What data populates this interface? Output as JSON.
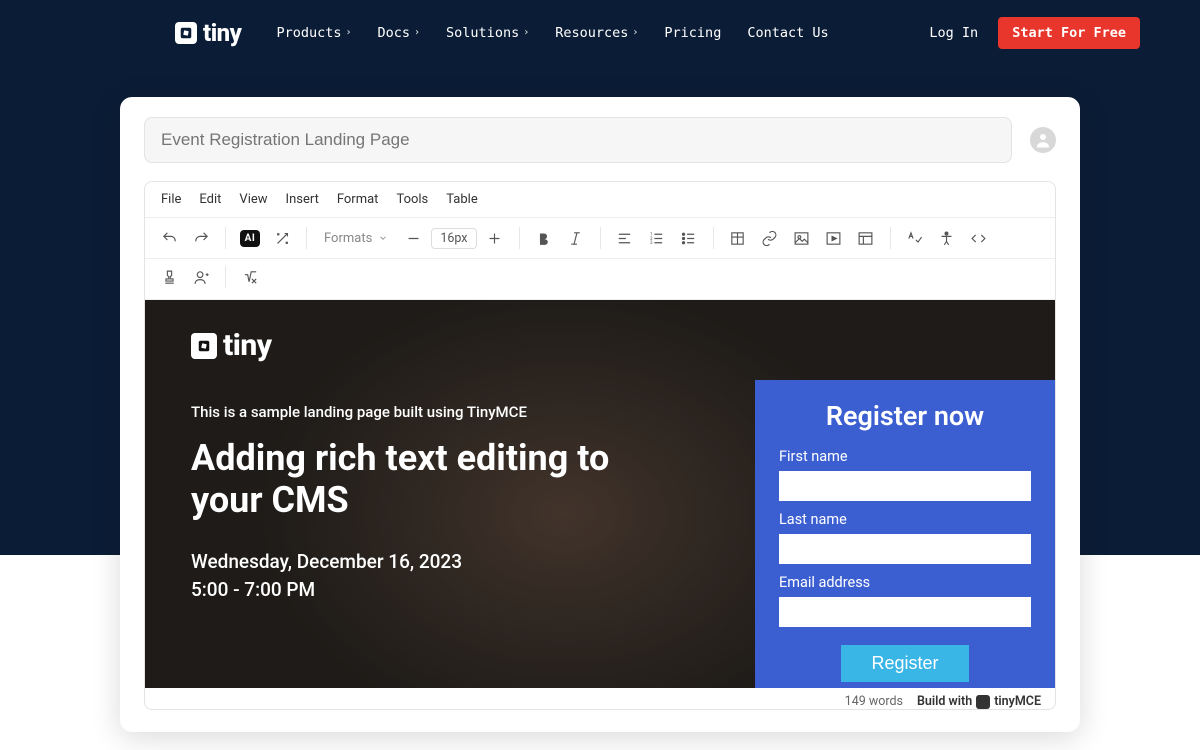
{
  "topbar": {
    "logo_text": "tiny",
    "nav": [
      "Products",
      "Docs",
      "Solutions",
      "Resources",
      "Pricing",
      "Contact Us"
    ],
    "login": "Log In",
    "cta": "Start For Free"
  },
  "card": {
    "title_placeholder": "Event Registration Landing Page"
  },
  "editor": {
    "menus": [
      "File",
      "Edit",
      "View",
      "Insert",
      "Format",
      "Tools",
      "Table"
    ],
    "formats_label": "Formats",
    "fontsize": "16px",
    "ai_label": "AI"
  },
  "content": {
    "inline_logo": "tiny",
    "subtitle": "This is a sample landing page built using TinyMCE",
    "headline": "Adding rich text editing to your CMS",
    "date": "Wednesday, December 16, 2023",
    "time": "5:00 - 7:00 PM"
  },
  "form": {
    "title": "Register now",
    "first_name_label": "First name",
    "last_name_label": "Last name",
    "email_label": "Email address",
    "submit": "Register"
  },
  "status": {
    "wordcount": "149 words",
    "buildwith": "Build with",
    "brand": "tinyMCE"
  }
}
